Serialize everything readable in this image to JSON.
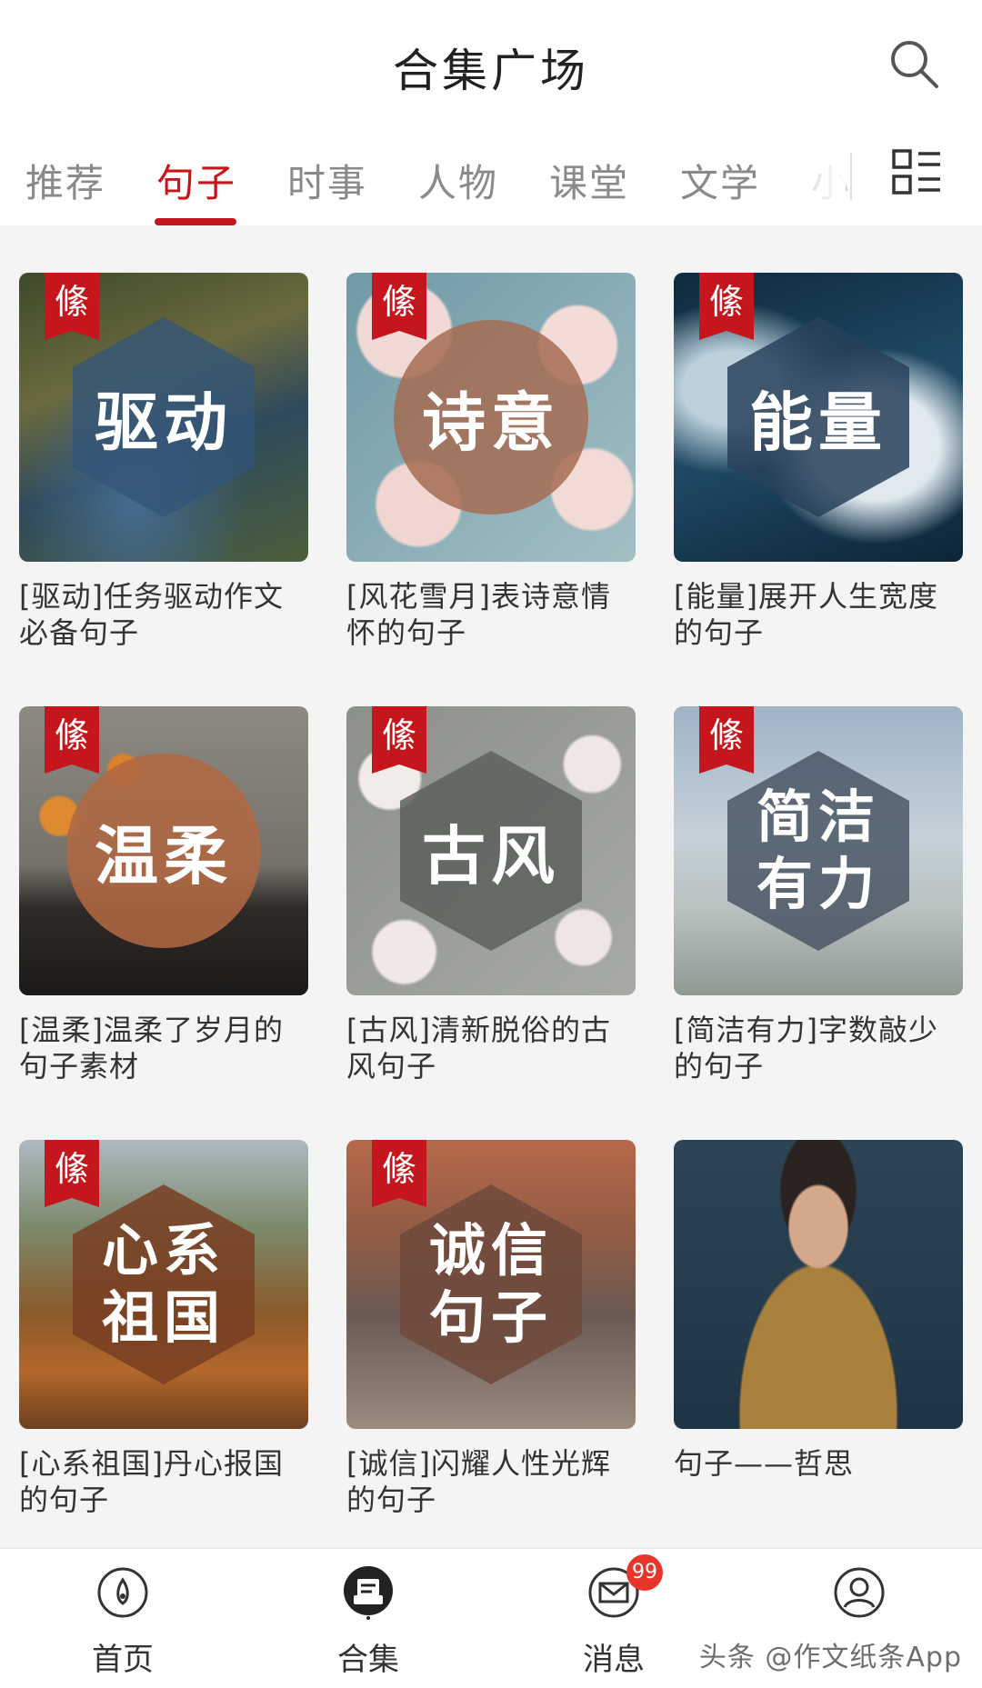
{
  "header": {
    "title": "合集广场"
  },
  "tabs": {
    "items": [
      "推荐",
      "句子",
      "时事",
      "人物",
      "课堂",
      "文学",
      "小"
    ],
    "active_index": 1
  },
  "cards": [
    {
      "overlay": "驱动",
      "overlay_shape": "hexagon",
      "badge": "絛",
      "caption": "[驱动]任务驱动作文必备句子"
    },
    {
      "overlay": "诗意",
      "overlay_shape": "circle",
      "badge": "絛",
      "caption": "[风花雪月]表诗意情怀的句子"
    },
    {
      "overlay": "能量",
      "overlay_shape": "hexagon",
      "badge": "絛",
      "caption": "[能量]展开人生宽度的句子"
    },
    {
      "overlay": "温柔",
      "overlay_shape": "circle",
      "badge": "絛",
      "caption": "[温柔]温柔了岁月的句子素材"
    },
    {
      "overlay": "古风",
      "overlay_shape": "hexagon",
      "badge": "絛",
      "caption": "[古风]清新脱俗的古风句子"
    },
    {
      "overlay_lines": [
        "简洁",
        "有力"
      ],
      "overlay_shape": "hexagon",
      "badge": "絛",
      "caption": "[简洁有力]字数敲少的句子"
    },
    {
      "overlay_lines": [
        "心系",
        "祖国"
      ],
      "overlay_shape": "hexagon",
      "badge": "絛",
      "caption": "[心系祖国]丹心报国的句子"
    },
    {
      "overlay_lines": [
        "诚信",
        "句子"
      ],
      "overlay_shape": "hexagon",
      "badge": "絛",
      "caption": "[诚信]闪耀人性光辉的句子"
    },
    {
      "caption": "句子——哲思"
    }
  ],
  "bottom_nav": {
    "items": [
      {
        "label": "首页",
        "icon": "compass-icon"
      },
      {
        "label": "合集",
        "icon": "collection-icon"
      },
      {
        "label": "消息",
        "icon": "mail-icon",
        "badge": "99"
      },
      {
        "label": "",
        "icon": "profile-icon"
      }
    ],
    "active_index": 1
  },
  "watermark": "头条 @作文纸条App",
  "colors": {
    "accent": "#c4161c",
    "badge_red": "#e8352b"
  }
}
